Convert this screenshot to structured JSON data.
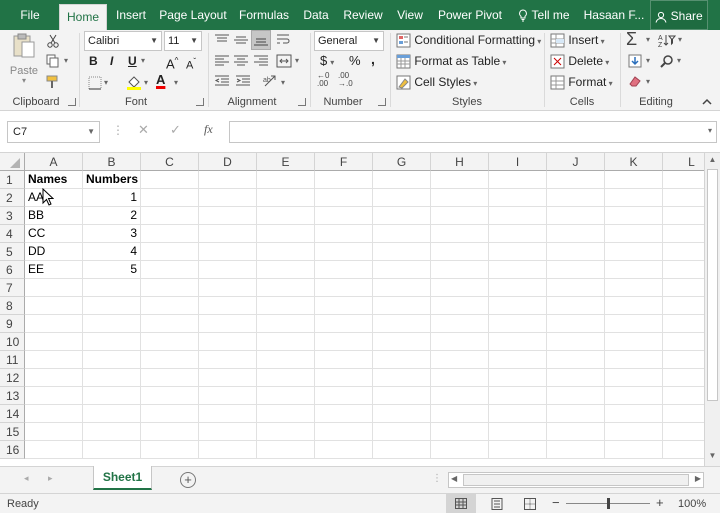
{
  "tabs": [
    {
      "label": "File"
    },
    {
      "label": "Home"
    },
    {
      "label": "Insert"
    },
    {
      "label": "Page Layout"
    },
    {
      "label": "Formulas"
    },
    {
      "label": "Data"
    },
    {
      "label": "Review"
    },
    {
      "label": "View"
    },
    {
      "label": "Power Pivot"
    },
    {
      "label": "Tell me"
    },
    {
      "label": "Hasaan F..."
    },
    {
      "label": "Share"
    }
  ],
  "ribbon": {
    "clipboard": {
      "paste": "Paste",
      "group": "Clipboard"
    },
    "font": {
      "name": "Calibri",
      "size": "11",
      "bold": "B",
      "italic": "I",
      "underline": "U",
      "grow": "A",
      "shrink": "A",
      "group": "Font"
    },
    "alignment": {
      "group": "Alignment"
    },
    "number": {
      "format": "General",
      "currency": "$",
      "percent": "%",
      "comma": ",",
      "group": "Number"
    },
    "styles": {
      "conditional": "Conditional Formatting",
      "table": "Format as Table",
      "cell": "Cell Styles",
      "group": "Styles"
    },
    "cells": {
      "insert": "Insert",
      "delete": "Delete",
      "format": "Format",
      "group": "Cells"
    },
    "editing": {
      "group": "Editing"
    }
  },
  "formula_bar": {
    "name_box": "C7",
    "fx": "fx",
    "formula": ""
  },
  "columns": [
    "A",
    "B",
    "C",
    "D",
    "E",
    "F",
    "G",
    "H",
    "I",
    "J",
    "K",
    "L"
  ],
  "rows": [
    "1",
    "2",
    "3",
    "4",
    "5",
    "6",
    "7",
    "8",
    "9",
    "10",
    "11",
    "12",
    "13",
    "14",
    "15",
    "16"
  ],
  "cells": {
    "A1": "Names",
    "B1": "Numbers",
    "A2": "AA",
    "B2": "1",
    "A3": "BB",
    "B3": "2",
    "A4": "CC",
    "B4": "3",
    "A5": "DD",
    "B5": "4",
    "A6": "EE",
    "B6": "5"
  },
  "sheet_tabs": [
    {
      "label": "Sheet1"
    }
  ],
  "status": {
    "ready": "Ready",
    "zoom": "100%",
    "zoom_level": 1.0
  },
  "colors": {
    "brand": "#217346",
    "ribbon_bg": "#f3f3f3",
    "grid_line": "#e1e1e1"
  }
}
